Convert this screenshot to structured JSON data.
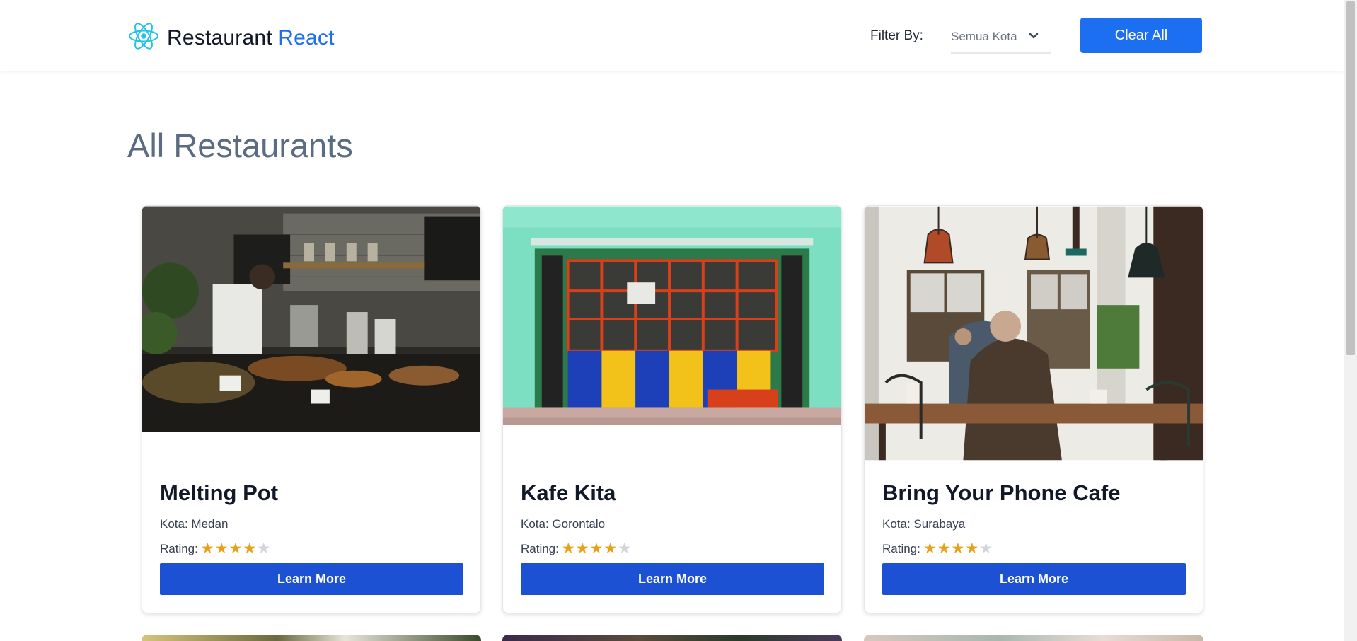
{
  "navbar": {
    "brand_part1": "Restaurant",
    "brand_part2": "React",
    "logo_icon": "react-atom-icon",
    "filter_label": "Filter By:",
    "filter_selected": "Semua Kota",
    "clear_button": "Clear All"
  },
  "main": {
    "title": "All Restaurants"
  },
  "colors": {
    "brand_accent": "#1d6ff2",
    "button_primary": "#1c51d4",
    "star_on": "#e6a118",
    "star_off": "#d1d5db",
    "title_gray": "#5b6b82"
  },
  "restaurants": [
    {
      "name": "Melting Pot",
      "kota": "Kota: Medan",
      "rating_label": "Rating:",
      "rating": 4,
      "rating_max": 5,
      "image": "cafe-kitchen-photo",
      "cta": "Learn More"
    },
    {
      "name": "Kafe Kita",
      "kota": "Kota: Gorontalo",
      "rating_label": "Rating:",
      "rating": 4,
      "rating_max": 5,
      "image": "turquoise-storefront-photo",
      "cta": "Learn More"
    },
    {
      "name": "Bring Your Phone Cafe",
      "kota": "Kota: Surabaya",
      "rating_label": "Rating:",
      "rating": 4,
      "rating_max": 5,
      "image": "cafe-interior-photo",
      "cta": "Learn More"
    }
  ]
}
